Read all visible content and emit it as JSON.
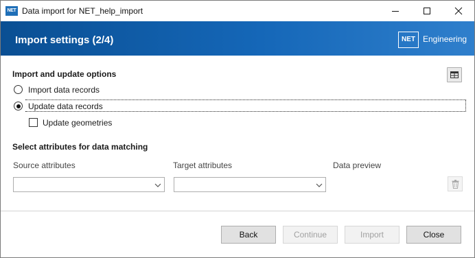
{
  "window": {
    "title": "Data import for NET_help_import",
    "app_icon": "NET"
  },
  "header": {
    "title": "Import settings (2/4)",
    "brand_logo": "NET",
    "brand_text": "Engineering"
  },
  "options": {
    "title": "Import and update options",
    "radio_import": {
      "label": "Import data records",
      "checked": false
    },
    "radio_update": {
      "label": "Update data records",
      "checked": true
    },
    "checkbox_geometries": {
      "label": "Update geometries",
      "checked": false
    }
  },
  "matching": {
    "title": "Select attributes for data matching",
    "source_label": "Source attributes",
    "target_label": "Target attributes",
    "preview_label": "Data preview",
    "source_value": "",
    "target_value": ""
  },
  "footer": {
    "back": "Back",
    "continue": "Continue",
    "import": "Import",
    "close": "Close"
  },
  "icons": [
    "minimize-icon",
    "maximize-icon",
    "close-icon",
    "table-icon",
    "trash-icon",
    "chevron-down-icon"
  ]
}
